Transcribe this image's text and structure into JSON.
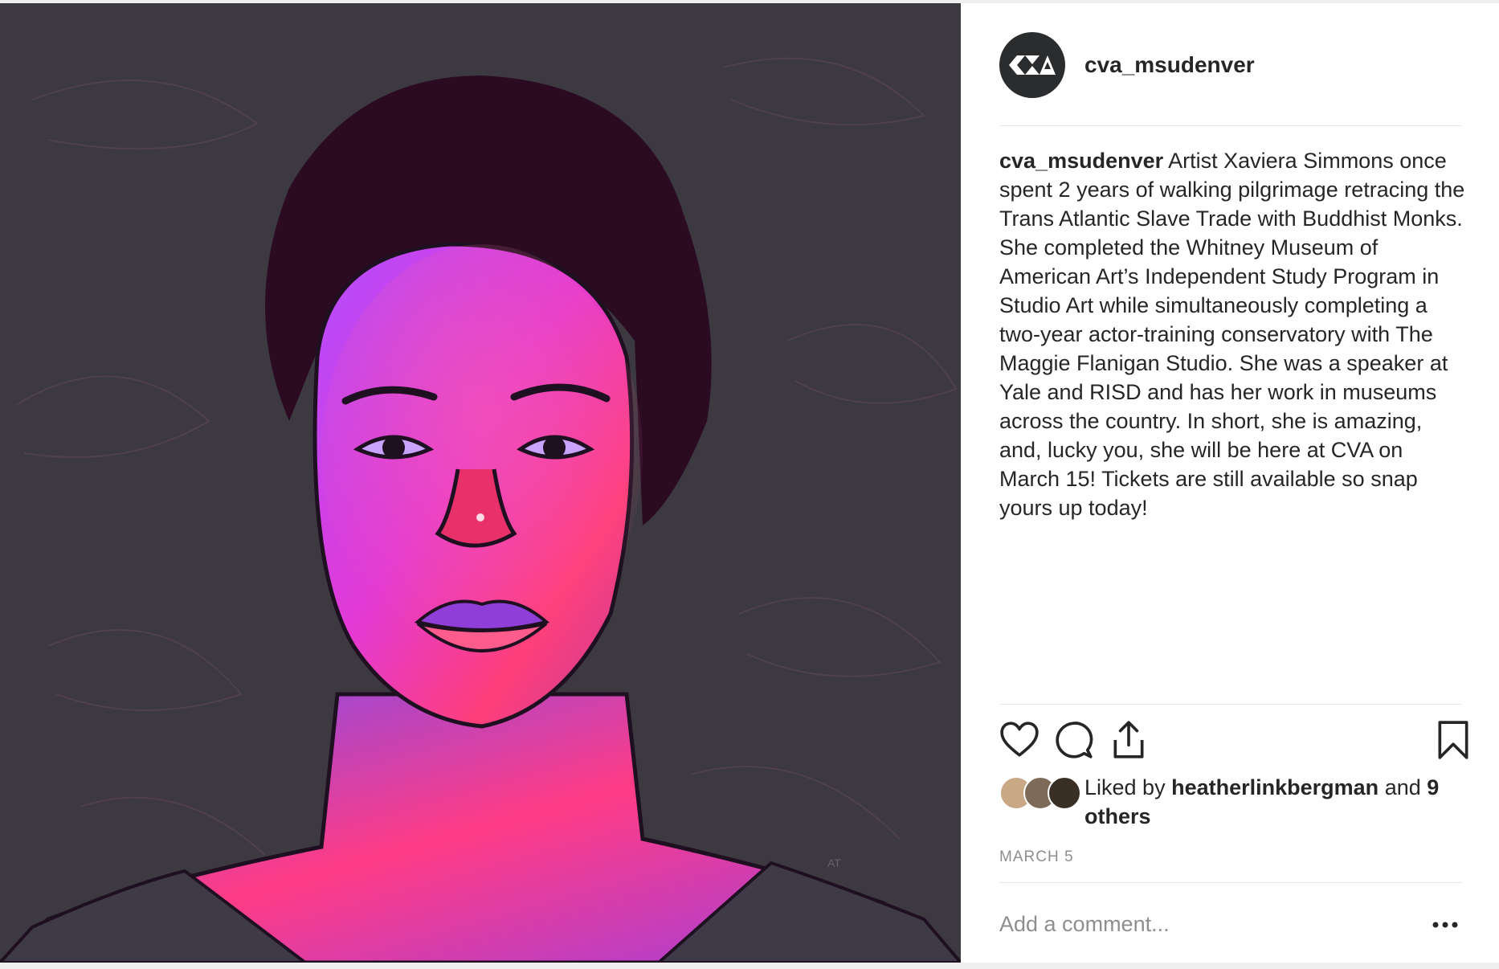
{
  "post": {
    "image_alt": "Illustrated portrait of a woman lit in magenta and violet tones",
    "username": "cva_msudenver",
    "caption_user": "cva_msudenver",
    "caption_text": "Artist Xaviera Simmons once spent 2 years of walking pilgrimage retracing the Trans Atlantic Slave Trade with Buddhist Monks. She completed the Whitney Museum of American Art’s Independent Study Program in Studio Art while simultaneously completing a two-year actor-training conservatory with The Maggie Flanigan Studio. She was a speaker at Yale and RISD and has her work in museums across the country. In short, she is amazing, and, lucky you, she will be here at CVA on March 15! Tickets are still available so snap yours up today!",
    "liked_by_prefix": "Liked by",
    "liked_by_user": "heatherlinkbergman",
    "liked_by_and": "and",
    "liked_by_others": "9 others",
    "date": "MARCH 5",
    "comment_placeholder": "Add a comment..."
  },
  "icons": {
    "like": "heart-icon",
    "comment": "comment-bubble-icon",
    "share": "share-icon",
    "save": "bookmark-icon",
    "more": "more-dots-icon"
  },
  "colors": {
    "text": "#262626",
    "secondary": "#8e8e8e",
    "divider": "#e6e6e6",
    "avatar_bg": "#2b2c2e",
    "photo_bg": "#3c3940"
  }
}
